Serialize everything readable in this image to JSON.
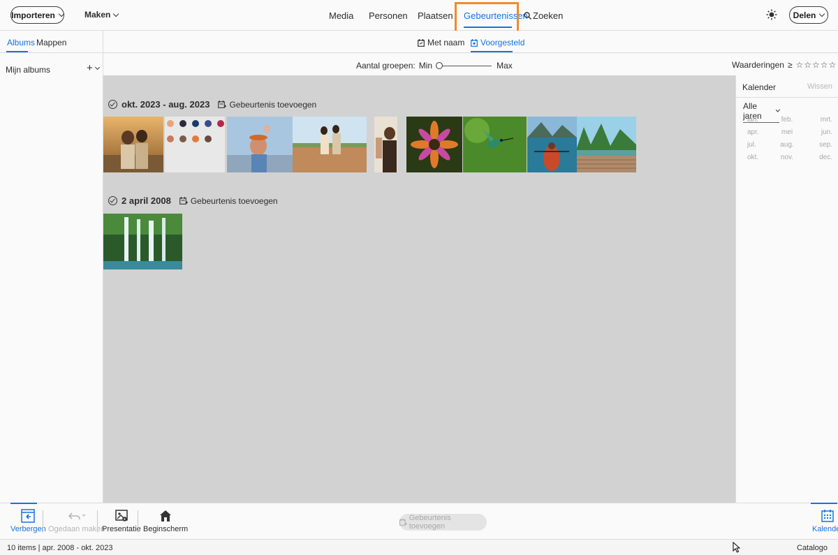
{
  "topbar": {
    "import_label": "Importeren",
    "create_label": "Maken",
    "tabs": [
      {
        "label": "Media"
      },
      {
        "label": "Personen"
      },
      {
        "label": "Plaatsen"
      },
      {
        "label": "Gebeurtenissen"
      }
    ],
    "search_label": "Zoeken",
    "share_label": "Delen",
    "highlight_color": "#f08a2c",
    "accent_color": "#1473e6"
  },
  "leftpanel": {
    "tabs": [
      {
        "label": "Albums"
      },
      {
        "label": "Mappen"
      }
    ],
    "my_albums": "Mijn albums",
    "add_symbol": "+"
  },
  "subtabs": {
    "by_name": "Met naam",
    "suggested": "Voorgesteld"
  },
  "filters": {
    "groups_label": "Aantal groepen:",
    "min": "Min",
    "max": "Max",
    "group_level": 0,
    "ratings_label": "Waarderingen",
    "ratings_op": "≥",
    "stars": "☆☆☆☆☆"
  },
  "groups": [
    {
      "title": "okt. 2023 - aug. 2023",
      "add_event": "Gebeurtenis toevoegen"
    },
    {
      "title": "2 april 2008",
      "add_event": "Gebeurtenis toevoegen"
    }
  ],
  "calendar": {
    "title": "Kalender",
    "clear": "Wissen",
    "years": "Alle jaren",
    "months": [
      "jan.",
      "feb.",
      "mrt.",
      "apr.",
      "mei",
      "jun.",
      "jul.",
      "aug.",
      "sep.",
      "okt.",
      "nov.",
      "dec."
    ]
  },
  "bottombar": {
    "hide": "Verbergen",
    "undo": "Ogedaan maken",
    "slideshow": "Presentatie",
    "home": "Beginscherm",
    "add_event": "Gebeurtenis toevoegen",
    "calendar": "Kalender"
  },
  "status": {
    "left": "10 items |  apr. 2008  - okt. 2023",
    "right": "Catalogo"
  }
}
